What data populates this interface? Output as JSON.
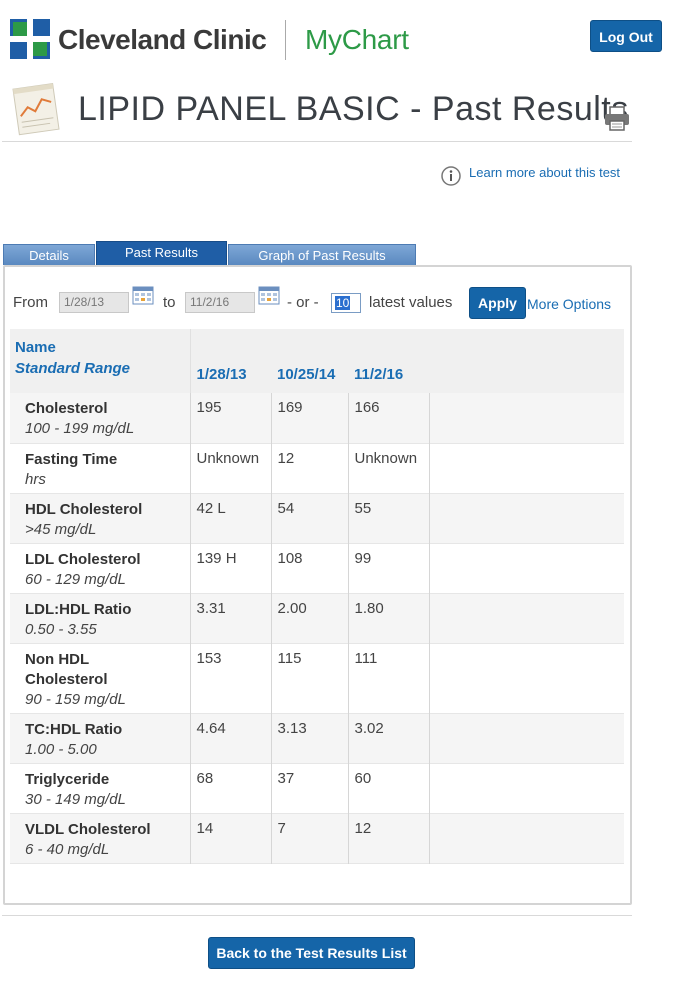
{
  "header": {
    "brand": "Cleveland Clinic",
    "product": "MyChart",
    "logout_label": "Log Out",
    "brand_color": "#1f5ea6",
    "product_color": "#2d9a47"
  },
  "page": {
    "title": "LIPID PANEL BASIC - Past Results",
    "learn_more": "Learn more about this test"
  },
  "tabs": [
    {
      "label": "Details",
      "active": false
    },
    {
      "label": "Past Results",
      "active": true
    },
    {
      "label": "Graph of Past Results",
      "active": false
    }
  ],
  "filter": {
    "from_label": "From",
    "from_value": "1/28/13",
    "to_label": "to",
    "to_value": "11/2/16",
    "or_label": "- or -",
    "count_value": "10",
    "latest_label": "latest values",
    "apply_label": "Apply",
    "more_options_label": "More Options"
  },
  "table": {
    "header_name": "Name",
    "header_range": "Standard Range",
    "dates": [
      "1/28/13",
      "10/25/14",
      "11/2/16"
    ],
    "rows": [
      {
        "name": "Cholesterol",
        "range": "100 - 199 mg/dL",
        "values": [
          "195",
          "169",
          "166"
        ]
      },
      {
        "name": "Fasting Time",
        "range": "hrs",
        "values": [
          "Unknown",
          "12",
          "Unknown"
        ]
      },
      {
        "name": "HDL Cholesterol",
        "range": ">45 mg/dL",
        "values": [
          "42 L",
          "54",
          "55"
        ]
      },
      {
        "name": "LDL Cholesterol",
        "range": "60 - 129 mg/dL",
        "values": [
          "139 H",
          "108",
          "99"
        ]
      },
      {
        "name": "LDL:HDL Ratio",
        "range": "0.50 - 3.55",
        "values": [
          "3.31",
          "2.00",
          "1.80"
        ]
      },
      {
        "name": "Non HDL Cholesterol",
        "range": "90 - 159 mg/dL",
        "values": [
          "153",
          "115",
          "111"
        ]
      },
      {
        "name": "TC:HDL Ratio",
        "range": "1.00 - 5.00",
        "values": [
          "4.64",
          "3.13",
          "3.02"
        ]
      },
      {
        "name": "Triglyceride",
        "range": "30 - 149 mg/dL",
        "values": [
          "68",
          "37",
          "60"
        ]
      },
      {
        "name": "VLDL Cholesterol",
        "range": "6 - 40 mg/dL",
        "values": [
          "14",
          "7",
          "12"
        ]
      }
    ]
  },
  "footer": {
    "back_label": "Back to the Test Results List"
  }
}
